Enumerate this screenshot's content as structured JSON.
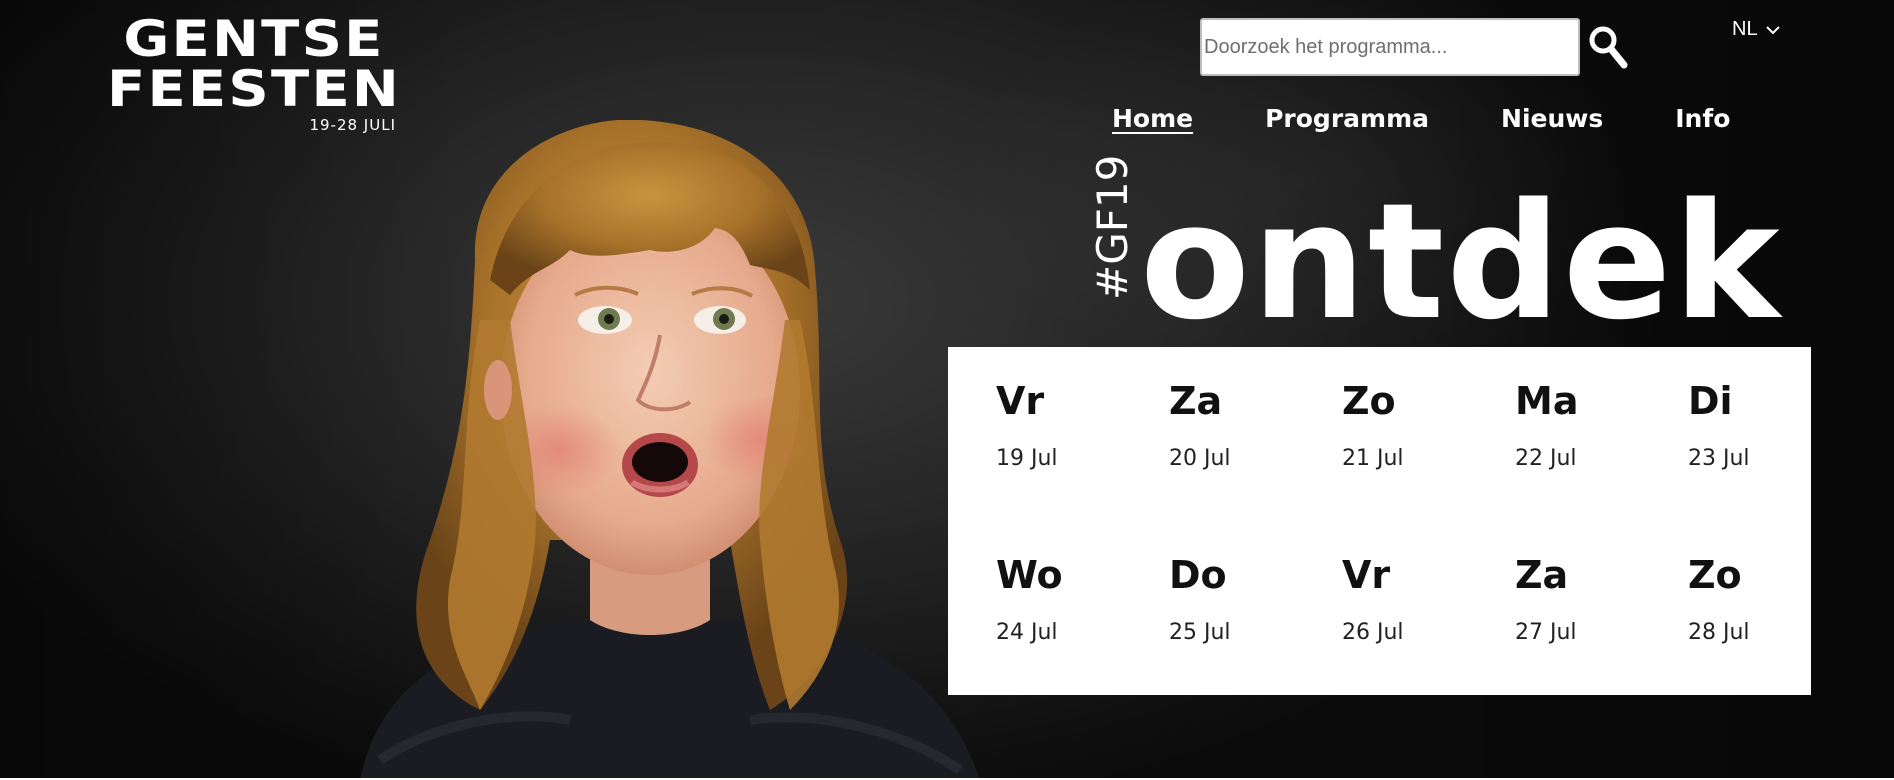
{
  "logo": {
    "line1": "GENTSE",
    "line2": "FEESTEN",
    "dates": "19-28 JULI"
  },
  "search": {
    "placeholder": "Doorzoek het programma...",
    "value": "",
    "icon": "search-icon"
  },
  "language": {
    "label": "NL",
    "icon": "chevron-down-icon"
  },
  "nav": {
    "items": [
      {
        "label": "Home",
        "active": true
      },
      {
        "label": "Programma",
        "active": false
      },
      {
        "label": "Nieuws",
        "active": false
      },
      {
        "label": "Info",
        "active": false
      }
    ]
  },
  "hero": {
    "hashtag": "#GF19",
    "headline": "ontdek"
  },
  "calendar": {
    "days": [
      {
        "name": "Vr",
        "date": "19 Jul"
      },
      {
        "name": "Za",
        "date": "20 Jul"
      },
      {
        "name": "Zo",
        "date": "21 Jul"
      },
      {
        "name": "Ma",
        "date": "22 Jul"
      },
      {
        "name": "Di",
        "date": "23 Jul"
      },
      {
        "name": "Wo",
        "date": "24 Jul"
      },
      {
        "name": "Do",
        "date": "25 Jul"
      },
      {
        "name": "Vr",
        "date": "26 Jul"
      },
      {
        "name": "Za",
        "date": "27 Jul"
      },
      {
        "name": "Zo",
        "date": "28 Jul"
      }
    ]
  },
  "colors": {
    "background": "#1f1f1f",
    "text_light": "#ffffff",
    "calendar_bg": "#ffffff",
    "calendar_text": "#111111"
  }
}
